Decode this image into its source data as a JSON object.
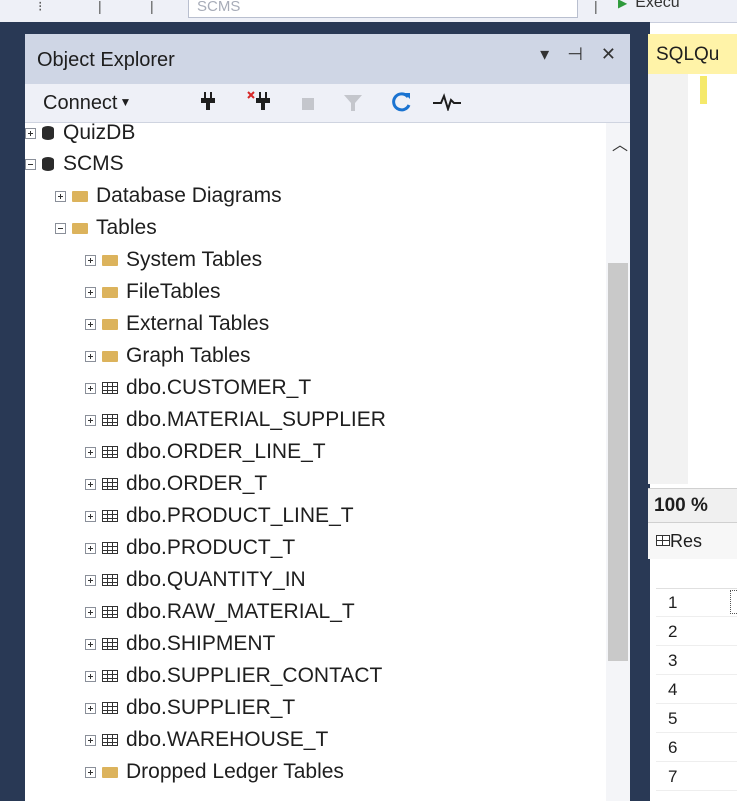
{
  "toolbar": {
    "database_combo": "SCMS",
    "execute_label": "Execu"
  },
  "object_explorer": {
    "title": "Object Explorer",
    "title_buttons": [
      "▾",
      "⊣",
      "✕"
    ],
    "connect_label": "Connect",
    "tools": [
      "connect-icon",
      "disconnect-icon",
      "stop-icon",
      "filter-icon",
      "refresh-icon",
      "activity-monitor-icon"
    ],
    "tree": [
      {
        "label": "QuizDB",
        "icon": "database-icon",
        "expanded": false,
        "level": 0
      },
      {
        "label": "SCMS",
        "icon": "database-icon",
        "expanded": true,
        "level": 0
      },
      {
        "label": "Database Diagrams",
        "icon": "folder-icon",
        "expanded": false,
        "level": 1
      },
      {
        "label": "Tables",
        "icon": "folder-icon",
        "expanded": true,
        "level": 1
      },
      {
        "label": "System Tables",
        "icon": "folder-icon",
        "expanded": false,
        "level": 2
      },
      {
        "label": "FileTables",
        "icon": "folder-icon",
        "expanded": false,
        "level": 2
      },
      {
        "label": "External Tables",
        "icon": "folder-icon",
        "expanded": false,
        "level": 2
      },
      {
        "label": "Graph Tables",
        "icon": "folder-icon",
        "expanded": false,
        "level": 2
      },
      {
        "label": "dbo.CUSTOMER_T",
        "icon": "table-icon",
        "expanded": false,
        "level": 2
      },
      {
        "label": "dbo.MATERIAL_SUPPLIER",
        "icon": "table-icon",
        "expanded": false,
        "level": 2
      },
      {
        "label": "dbo.ORDER_LINE_T",
        "icon": "table-icon",
        "expanded": false,
        "level": 2
      },
      {
        "label": "dbo.ORDER_T",
        "icon": "table-icon",
        "expanded": false,
        "level": 2
      },
      {
        "label": "dbo.PRODUCT_LINE_T",
        "icon": "table-icon",
        "expanded": false,
        "level": 2
      },
      {
        "label": "dbo.PRODUCT_T",
        "icon": "table-icon",
        "expanded": false,
        "level": 2
      },
      {
        "label": "dbo.QUANTITY_IN",
        "icon": "table-icon",
        "expanded": false,
        "level": 2
      },
      {
        "label": "dbo.RAW_MATERIAL_T",
        "icon": "table-icon",
        "expanded": false,
        "level": 2
      },
      {
        "label": "dbo.SHIPMENT",
        "icon": "table-icon",
        "expanded": false,
        "level": 2
      },
      {
        "label": "dbo.SUPPLIER_CONTACT",
        "icon": "table-icon",
        "expanded": false,
        "level": 2
      },
      {
        "label": "dbo.SUPPLIER_T",
        "icon": "table-icon",
        "expanded": false,
        "level": 2
      },
      {
        "label": "dbo.WAREHOUSE_T",
        "icon": "table-icon",
        "expanded": false,
        "level": 2
      },
      {
        "label": "Dropped Ledger Tables",
        "icon": "folder-icon",
        "expanded": false,
        "level": 2
      }
    ]
  },
  "query": {
    "tab_label": "SQLQu",
    "zoom": "100 %",
    "results_tab": "Res",
    "row_numbers": [
      "1",
      "2",
      "3",
      "4",
      "5",
      "6",
      "7"
    ]
  },
  "colors": {
    "frame": "#293955",
    "title_bar": "#cfd6e5",
    "query_tab": "#fff3a8",
    "folder": "#dcb35c"
  }
}
